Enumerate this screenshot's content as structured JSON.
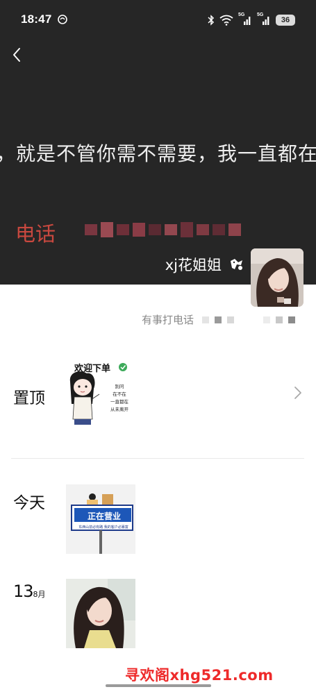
{
  "status_bar": {
    "time": "18:47",
    "network_1": "5G",
    "network_2": "5G",
    "battery": "36"
  },
  "icons": {
    "back": "chevron-left-icon",
    "bluetooth": "bluetooth-icon",
    "wifi": "wifi-icon",
    "signal": "cellular-signal-icon",
    "nickname_badge": "status-sticker-icon",
    "chevron": "chevron-right-icon"
  },
  "profile": {
    "cover_text": "，就是不管你需不需要，我一直都在",
    "cover_phone_label": "电话",
    "nickname": "xj花姐姐",
    "signature": "有事打电话"
  },
  "timeline": {
    "pinned_label": "置顶",
    "pinned_image": {
      "title": "欢迎下单",
      "lines": [
        "别问",
        "在不在",
        "一直都在",
        "从未离开"
      ]
    },
    "today_label": "今天",
    "today_image": {
      "sign": "正在营业",
      "sub": "东西山前必有路   我的客户必暴富"
    },
    "date_day": "13",
    "date_month": "8月"
  },
  "watermark": "寻欢阁xhg521.com",
  "colors": {
    "cover_bg": "#262626",
    "phone_label": "#c9483f",
    "watermark": "#ee2a2a",
    "signature": "#888888"
  }
}
